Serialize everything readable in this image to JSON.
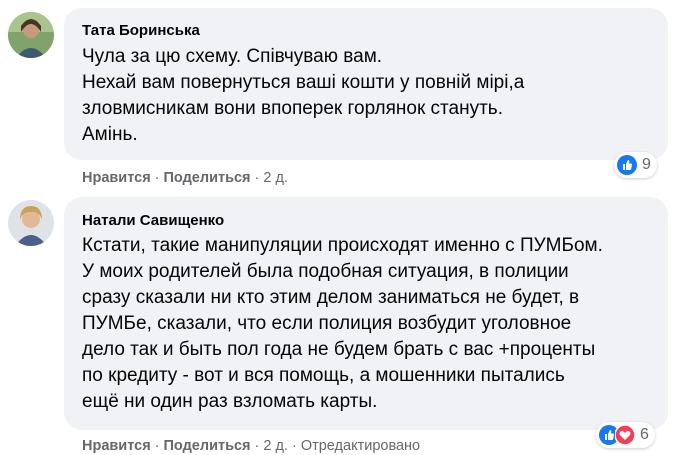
{
  "comments": [
    {
      "author": "Тата Боринська",
      "lines": [
        "Чула за цю схему. Співчуваю вам.",
        "Нехай вам повернуться ваші кошти у повній мірі,а",
        "зловмисникам вони впоперек горлянок стануть.",
        "Амінь."
      ],
      "like_label": "Нравится",
      "reply_label": "Поделиться",
      "time": "2 д.",
      "edited": "",
      "reaction_icons": [
        "like-icon"
      ],
      "reaction_count": "9"
    },
    {
      "author": "Натали Савищенко",
      "lines": [
        "Кстати, такие манипуляции происходят именно с ПУМБом.",
        "У моих родителей была подобная ситуация, в полиции",
        "сразу сказали ни кто этим делом заниматься не будет, в",
        "ПУМБе, сказали, что если полиция возбудит уголовное",
        "дело так и быть пол года не будем брать с вас +проценты",
        "по кредиту - вот и вся помощь, а мошенники пытались",
        "ещё ни один раз взломать карты."
      ],
      "like_label": "Нравится",
      "reply_label": "Поделиться",
      "time": "2 д.",
      "edited": "Отредактировано",
      "reaction_icons": [
        "like-icon",
        "love-icon"
      ],
      "reaction_count": "6"
    }
  ],
  "separator": "·",
  "colors": {
    "bubble": "#f0f2f5",
    "meta_text": "#65676b",
    "like_blue": "#1877f2",
    "love_red": "#f33e58"
  }
}
